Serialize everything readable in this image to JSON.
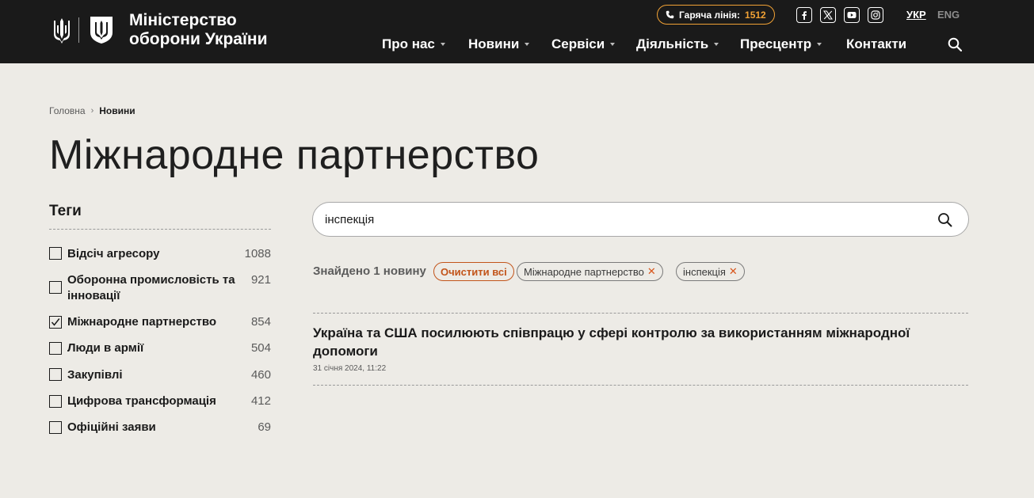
{
  "header": {
    "logo_text": "Міністерство оборони України",
    "hotline_label": "Гаряча лінія:",
    "hotline_number": "1512",
    "social": [
      "facebook-icon",
      "x-twitter-icon",
      "youtube-icon",
      "instagram-icon"
    ],
    "lang_active": "УКР",
    "lang_inactive": "ENG",
    "nav": [
      "Про нас",
      "Новини",
      "Сервіси",
      "Діяльність",
      "Пресцентр",
      "Контакти"
    ],
    "accent": "#f1a235",
    "bg": "#1a1a1a"
  },
  "breadcrumb": {
    "home": "Головна",
    "current": "Новини"
  },
  "page_title": "Міжнародне партнерство",
  "tags": {
    "title": "Теги",
    "items": [
      {
        "label": "Відсіч агресору",
        "count": "1088",
        "checked": false
      },
      {
        "label": "Оборонна промисловість та інновації",
        "count": "921",
        "checked": false
      },
      {
        "label": "Міжнародне партнерство",
        "count": "854",
        "checked": true
      },
      {
        "label": "Люди в армії",
        "count": "504",
        "checked": false
      },
      {
        "label": "Закупівлі",
        "count": "460",
        "checked": false
      },
      {
        "label": "Цифрова трансформація",
        "count": "412",
        "checked": false
      },
      {
        "label": "Офіційні заяви",
        "count": "69",
        "checked": false
      }
    ]
  },
  "search": {
    "value": "інспекція"
  },
  "filters": {
    "found_text": "Знайдено 1 новину",
    "clear_label": "Очистити всі",
    "chips": [
      "Міжнародне партнерство",
      "інспекція"
    ]
  },
  "results": [
    {
      "title": "Україна та США посилюють співпрацю у сфері контролю за використанням міжнародної допомоги",
      "date": "31 січня 2024, 11:22"
    }
  ]
}
